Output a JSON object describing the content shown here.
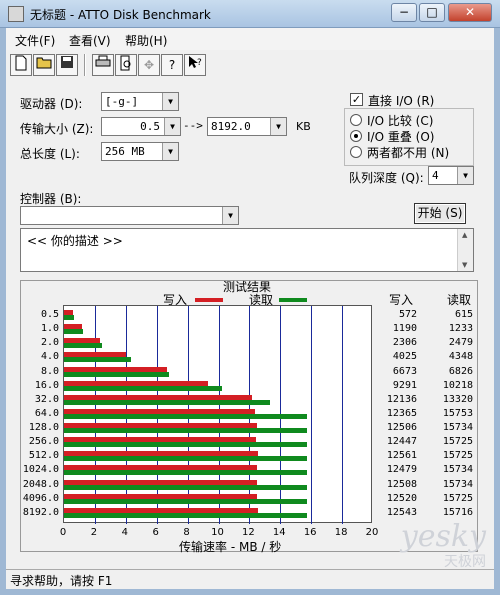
{
  "window": {
    "title": "无标题 - ATTO Disk Benchmark",
    "controls": {
      "minimize": "−",
      "maximize": "□",
      "close": "✕"
    }
  },
  "menu": [
    "文件(F)",
    "查看(V)",
    "帮助(H)"
  ],
  "toolbar_icons": [
    "new-icon",
    "open-icon",
    "save-icon",
    "print-icon",
    "print-preview-icon",
    "move-icon",
    "help-icon",
    "context-help-icon"
  ],
  "settings": {
    "drive_label": "驱动器 (D):",
    "drive_value": "[-g-]",
    "transfer_label": "传输大小 (Z):",
    "transfer_from": "0.5",
    "transfer_arrow": "-->",
    "transfer_to": "8192.0",
    "transfer_unit": "KB",
    "length_label": "总长度 (L):",
    "length_value": "256 MB",
    "direct_io_label": "直接 I/O (R)",
    "direct_io_checked": true,
    "io_compare_label": "I/O 比较 (C)",
    "io_overlap_label": "I/O 重叠 (O)",
    "neither_label": "两者都不用 (N)",
    "io_selected": "I/O 重叠 (O)",
    "queue_label": "队列深度 (Q):",
    "queue_value": "4",
    "controller_label": "控制器 (B):",
    "controller_value": "",
    "start_label": "开始 (S)",
    "description_text": "<<    你的描述    >>"
  },
  "results": {
    "title": "测试结果",
    "legend_write": "写入",
    "legend_read": "读取",
    "col_write": "写入",
    "col_read": "读取",
    "write_color": "#d41f24",
    "read_color": "#0f8a1e"
  },
  "chart_data": {
    "type": "bar",
    "orientation": "horizontal",
    "title": "测试结果",
    "xlabel": "传输速率 - MB / 秒",
    "ylabel": "",
    "xlim": [
      0,
      20
    ],
    "xticks": [
      "0",
      "2",
      "4",
      "6",
      "8",
      "10",
      "12",
      "14",
      "16",
      "18",
      "20"
    ],
    "categories": [
      "0.5",
      "1.0",
      "2.0",
      "4.0",
      "8.0",
      "16.0",
      "32.0",
      "64.0",
      "128.0",
      "256.0",
      "512.0",
      "1024.0",
      "2048.0",
      "4096.0",
      "8192.0"
    ],
    "series": [
      {
        "name": "写入",
        "color": "#d41f24",
        "values": [
          0.572,
          1.19,
          2.306,
          4.025,
          6.673,
          9.291,
          12.136,
          12.365,
          12.506,
          12.447,
          12.561,
          12.479,
          12.508,
          12.52,
          12.543
        ]
      },
      {
        "name": "读取",
        "color": "#0f8a1e",
        "values": [
          0.615,
          1.233,
          2.479,
          4.348,
          6.826,
          10.218,
          13.32,
          15.753,
          15.734,
          15.725,
          15.725,
          15.734,
          15.734,
          15.725,
          15.716
        ]
      }
    ],
    "table": {
      "write": [
        "572",
        "1190",
        "2306",
        "4025",
        "6673",
        "9291",
        "12136",
        "12365",
        "12506",
        "12447",
        "12561",
        "12479",
        "12508",
        "12520",
        "12543"
      ],
      "read": [
        "615",
        "1233",
        "2479",
        "4348",
        "6826",
        "10218",
        "13320",
        "15753",
        "15734",
        "15725",
        "15725",
        "15734",
        "15734",
        "15725",
        "15716"
      ]
    },
    "grid": true,
    "legend": "top-center"
  },
  "statusbar": {
    "text": "寻求帮助，请按 F1"
  },
  "watermark": {
    "brand": "yesky",
    "cn": "天极网"
  }
}
